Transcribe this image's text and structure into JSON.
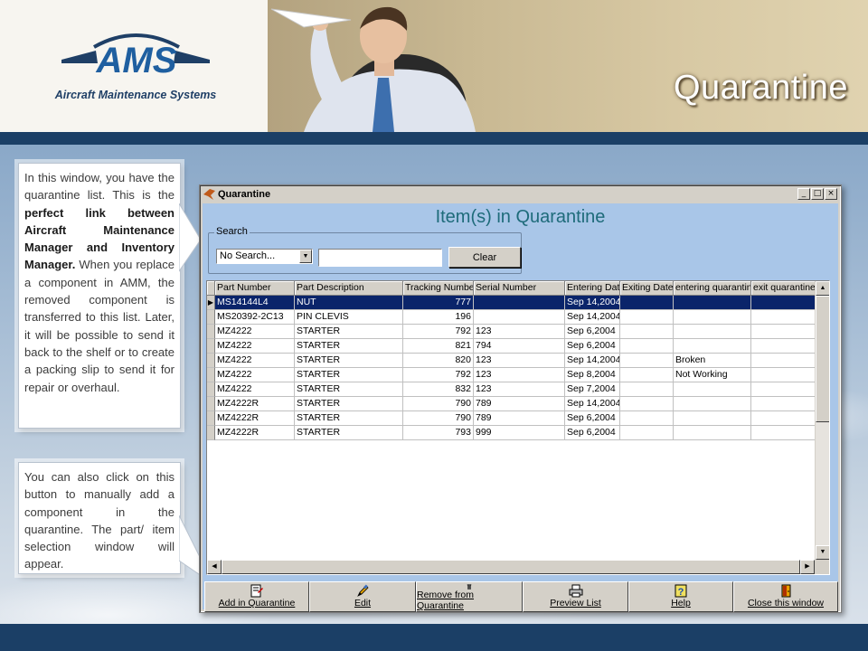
{
  "slide": {
    "logo_letters": "AMS",
    "logo_tagline": "Aircraft Maintenance Systems",
    "title": "Quarantine"
  },
  "callouts": [
    {
      "parts": [
        {
          "text": "In this window, you have the quarantine list. This is the ",
          "bold": false
        },
        {
          "text": "perfect link between Aircraft Maintenance Manager and Inventory Manager.",
          "bold": true
        },
        {
          "text": " When you replace a component in AMM, the removed component is transferred to this list. Later, it will be possible to send it back to the shelf or to create a packing slip to send it for repair or overhaul.",
          "bold": false
        }
      ]
    },
    {
      "parts": [
        {
          "text": "You can also click on this button to manually add a component in the quarantine. The part/ item selection window will appear.",
          "bold": false
        }
      ]
    }
  ],
  "window": {
    "title": "Quarantine",
    "heading": "Item(s) in Quarantine",
    "search": {
      "legend": "Search",
      "selected": "No Search...",
      "input_value": "",
      "clear_label": "Clear"
    },
    "columns": [
      "Part Number",
      "Part Description",
      "Tracking Number",
      "Serial Number",
      "Entering Date",
      "Exiting Date",
      "entering quarantine",
      "exit quarantine"
    ],
    "rows": [
      [
        "MS14144L4",
        "NUT",
        "777",
        "",
        "Sep 14,2004",
        "",
        "",
        ""
      ],
      [
        "MS20392-2C13",
        "PIN CLEVIS",
        "196",
        "",
        "Sep 14,2004",
        "",
        "",
        ""
      ],
      [
        "MZ4222",
        "STARTER",
        "792",
        "123",
        "Sep 6,2004",
        "",
        "",
        ""
      ],
      [
        "MZ4222",
        "STARTER",
        "821",
        "794",
        "Sep 6,2004",
        "",
        "",
        ""
      ],
      [
        "MZ4222",
        "STARTER",
        "820",
        "123",
        "Sep 14,2004",
        "",
        "Broken",
        ""
      ],
      [
        "MZ4222",
        "STARTER",
        "792",
        "123",
        "Sep 8,2004",
        "",
        "Not Working",
        ""
      ],
      [
        "MZ4222",
        "STARTER",
        "832",
        "123",
        "Sep 7,2004",
        "",
        "",
        ""
      ],
      [
        "MZ4222R",
        "STARTER",
        "790",
        "789",
        "Sep 14,2004",
        "",
        "",
        ""
      ],
      [
        "MZ4222R",
        "STARTER",
        "790",
        "789",
        "Sep 6,2004",
        "",
        "",
        ""
      ],
      [
        "MZ4222R",
        "STARTER",
        "793",
        "999",
        "Sep 6,2004",
        "",
        "",
        ""
      ]
    ],
    "selected_row": 0,
    "toolbar": [
      {
        "key": "add",
        "label": "Add in Quarantine",
        "icon": "add-document-icon"
      },
      {
        "key": "edit",
        "label": "Edit",
        "icon": "pencil-icon"
      },
      {
        "key": "remove",
        "label": "Remove from Quarantine",
        "icon": "trash-icon"
      },
      {
        "key": "preview",
        "label": "Preview List",
        "icon": "printer-icon"
      },
      {
        "key": "help",
        "label": "Help",
        "icon": "help-icon"
      },
      {
        "key": "close",
        "label": "Close this window",
        "icon": "exit-door-icon"
      }
    ]
  },
  "colors": {
    "header_band": "#1b3f66",
    "client_background": "#a9c6e8",
    "heading_text": "#1e6b7a",
    "selected_row": "#0a246a",
    "logo_blue": "#1f5fa0"
  }
}
